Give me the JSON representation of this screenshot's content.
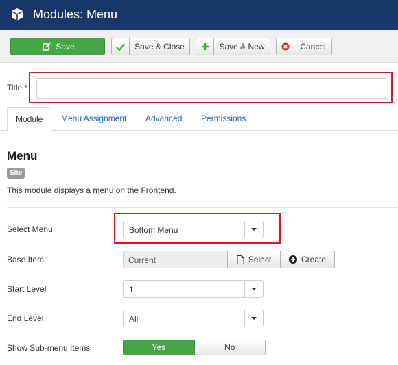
{
  "header": {
    "title": "Modules: Menu",
    "icon": "cube-icon"
  },
  "toolbar": {
    "save_label": "Save",
    "save_close_label": "Save & Close",
    "save_new_label": "Save & New",
    "cancel_label": "Cancel"
  },
  "title_field": {
    "label": "Title *",
    "value": ""
  },
  "tabs": [
    {
      "label": "Module",
      "active": true
    },
    {
      "label": "Menu Assignment",
      "active": false
    },
    {
      "label": "Advanced",
      "active": false
    },
    {
      "label": "Permissions",
      "active": false
    }
  ],
  "module": {
    "heading": "Menu",
    "badge": "Site",
    "description": "This module displays a menu on the Frontend."
  },
  "fields": {
    "select_menu": {
      "label": "Select Menu",
      "value": "Bottom Menu"
    },
    "base_item": {
      "label": "Base Item",
      "value": "Current",
      "select_label": "Select",
      "create_label": "Create"
    },
    "start_level": {
      "label": "Start Level",
      "value": "1"
    },
    "end_level": {
      "label": "End Level",
      "value": "All"
    },
    "show_submenu": {
      "label": "Show Sub-menu Items",
      "yes_label": "Yes",
      "no_label": "No",
      "selected": "Yes"
    }
  },
  "colors": {
    "header_bg": "#1a3867",
    "save_green": "#46a546",
    "highlight_red": "#e3141a",
    "link_blue": "#1a66a8",
    "cancel_icon_red": "#bd362f"
  }
}
